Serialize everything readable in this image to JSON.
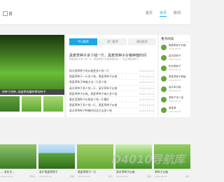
{
  "header": {
    "site_name": "首",
    "nav": [
      "首页",
      "资讯",
      "新闻"
    ],
    "active_nav": "资讯"
  },
  "hero": {
    "caption": "的种子的种, 阔度草的藤种草的种子"
  },
  "tabs": {
    "items": [
      "今日推荐",
      "热门推荐",
      "随机推荐"
    ]
  },
  "feature": {
    "title": "黑麦草种子多少钱一斤，黑麦草种子价格种植时间",
    "desc": "黑麦草种子多少钱一斤，黑麦草种子价格种植时间，一年生黑麦草种子……"
  },
  "list": [
    {
      "title": "狗牙根草种子的价格是多少钱一斤",
      "date": "2024-04-01"
    },
    {
      "title": "黑麦草种子一斤多少钱，黑麦草种子价格",
      "date": "2024-04-01"
    },
    {
      "title": "黑麦草种子种植方法一斤多少钱",
      "date": "2024-04-01"
    },
    {
      "title": "高羊茅种子多少钱一斤，高羊茅种子价格",
      "date": "2024-04-01"
    },
    {
      "title": "黑麦草种子价格，黑麦草种子每斤多少钱",
      "date": "2024-04-01"
    },
    {
      "title": "紫花苜蓿种子价格多少钱一斤最好",
      "date": "2024-04-01"
    },
    {
      "title": "黑麦草种子多少钱一斤，黑麦草种子价格",
      "date": "2024-04-01"
    },
    {
      "title": "高羊茅草种子种植时间及方法多少钱",
      "date": "2024-04-01"
    }
  ],
  "sidebar": {
    "title": "重点阅读",
    "items": [
      {
        "title": "黑麦草种子价格",
        "date": "2024-04-01"
      },
      {
        "title": "高羊茅种子",
        "date": "2024-04-01"
      },
      {
        "title": "狗牙根种子",
        "date": "2024-04-01"
      },
      {
        "title": "黑麦草种子种植",
        "date": "2024-04-01"
      },
      {
        "title": "高羊茅价格",
        "date": "2024-04-01"
      },
      {
        "title": "草种子多少钱",
        "date": "2024-04-01"
      },
      {
        "title": "黑麦草",
        "date": "2024-04-01"
      }
    ]
  },
  "gallery": [
    {
      "title": "… 多年生…",
      "date": "2024-04-02",
      "tag": "草种子"
    },
    {
      "title": "高产黑麦草种子",
      "date": "2024-04-02",
      "tag": "草种"
    },
    {
      "title": "黑麦草种子一斤",
      "date": "2024-04-02",
      "tag": "种子"
    },
    {
      "title": "高羊茅种子价格",
      "date": "2024-04-02",
      "tag": "草种"
    },
    {
      "title": "草种子价格",
      "date": "2024-04-02",
      "tag": "种子"
    }
  ],
  "watermark": "D4010导航库"
}
